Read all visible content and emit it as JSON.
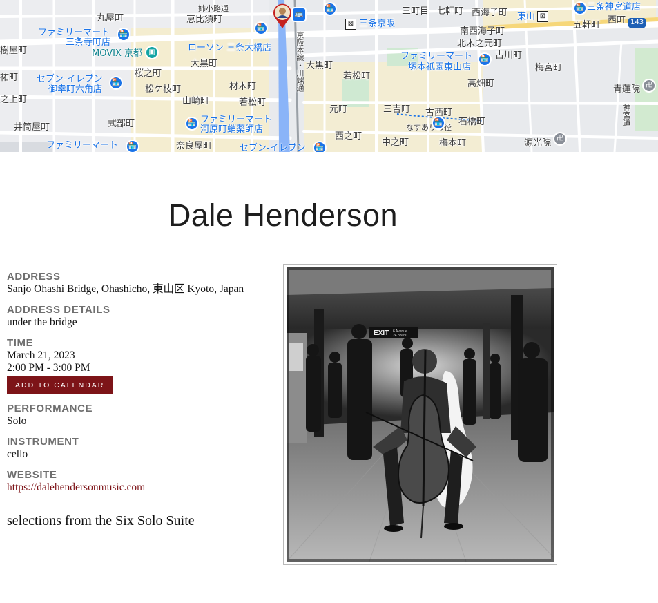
{
  "map": {
    "labels": [
      {
        "text": "丸屋町",
        "cls": ""
      },
      {
        "text": "姉小路通",
        "cls": "small"
      },
      {
        "text": "恵比須町",
        "cls": ""
      },
      {
        "text": "ファミリーマート",
        "cls": "blue"
      },
      {
        "text": "三条寺町店",
        "cls": "blue"
      },
      {
        "text": "MOVIX 京都",
        "cls": "teal"
      },
      {
        "text": "ローソン 三条大橋店",
        "cls": "blue"
      },
      {
        "text": "大黒町",
        "cls": ""
      },
      {
        "text": "桜之町",
        "cls": ""
      },
      {
        "text": "セブン-イレブン",
        "cls": "blue"
      },
      {
        "text": "御幸町六角店",
        "cls": "blue"
      },
      {
        "text": "松ケ枝町",
        "cls": ""
      },
      {
        "text": "材木町",
        "cls": ""
      },
      {
        "text": "山崎町",
        "cls": ""
      },
      {
        "text": "若松町",
        "cls": ""
      },
      {
        "text": "ファミリーマート",
        "cls": "blue"
      },
      {
        "text": "河原町蛸薬師店",
        "cls": "blue"
      },
      {
        "text": "式部町",
        "cls": ""
      },
      {
        "text": "井筒屋町",
        "cls": ""
      },
      {
        "text": "ファミリーマート",
        "cls": "blue"
      },
      {
        "text": "奈良屋町",
        "cls": ""
      },
      {
        "text": "セブン-イレブン",
        "cls": "blue"
      },
      {
        "text": "三条京阪",
        "cls": "blue"
      },
      {
        "text": "大黒町",
        "cls": ""
      },
      {
        "text": "若松町",
        "cls": ""
      },
      {
        "text": "元町",
        "cls": ""
      },
      {
        "text": "三吉町",
        "cls": ""
      },
      {
        "text": "古西町",
        "cls": ""
      },
      {
        "text": "西之町",
        "cls": ""
      },
      {
        "text": "中之町",
        "cls": ""
      },
      {
        "text": "梅本町",
        "cls": ""
      },
      {
        "text": "なすありの径",
        "cls": "small"
      },
      {
        "text": "石橋町",
        "cls": ""
      },
      {
        "text": "三町目",
        "cls": ""
      },
      {
        "text": "七軒町",
        "cls": ""
      },
      {
        "text": "西海子町",
        "cls": ""
      },
      {
        "text": "東山",
        "cls": "blue"
      },
      {
        "text": "南西海子町",
        "cls": ""
      },
      {
        "text": "北木之元町",
        "cls": ""
      },
      {
        "text": "ファミリーマート",
        "cls": "blue"
      },
      {
        "text": "塚本祇園東山店",
        "cls": "blue"
      },
      {
        "text": "古川町",
        "cls": ""
      },
      {
        "text": "高畑町",
        "cls": ""
      },
      {
        "text": "梅宮町",
        "cls": ""
      },
      {
        "text": "五軒町",
        "cls": ""
      },
      {
        "text": "三条神宮道店",
        "cls": "blue"
      },
      {
        "text": "西町",
        "cls": ""
      },
      {
        "text": "青蓮院",
        "cls": ""
      },
      {
        "text": "源光院",
        "cls": ""
      },
      {
        "text": "神宮道",
        "cls": "small"
      },
      {
        "text": "樹屋町",
        "cls": ""
      },
      {
        "text": "祐町",
        "cls": ""
      },
      {
        "text": "之上町",
        "cls": ""
      },
      {
        "text": "京阪本線・川端通",
        "cls": "small"
      },
      {
        "text": "143",
        "cls": ""
      }
    ]
  },
  "artist": {
    "name": "Dale Henderson",
    "address_label": "ADDRESS",
    "address": "Sanjo Ohashi Bridge, Ohashicho, 東山区 Kyoto, Japan",
    "address_details_label": "ADDRESS DETAILS",
    "address_details": "under the bridge",
    "time_label": "TIME",
    "date": "March 21, 2023",
    "time_range": "2:00 PM - 3:00 PM",
    "calendar_button": "ADD TO CALENDAR",
    "performance_label": "PERFORMANCE",
    "performance": "Solo",
    "instrument_label": "INSTRUMENT",
    "instrument": "cello",
    "website_label": "WEBSITE",
    "website": "https://dalehendersonmusic.com",
    "description": "selections from the Six Solo Suite"
  },
  "colors": {
    "accent": "#7d1418",
    "label_grey": "#6f6f6f",
    "map_blue_labels": "#1a73e8"
  },
  "photo": {
    "sign_text": "EXIT",
    "sign_sub_1": "6 Avenue",
    "sign_sub_2": "24 hours"
  }
}
